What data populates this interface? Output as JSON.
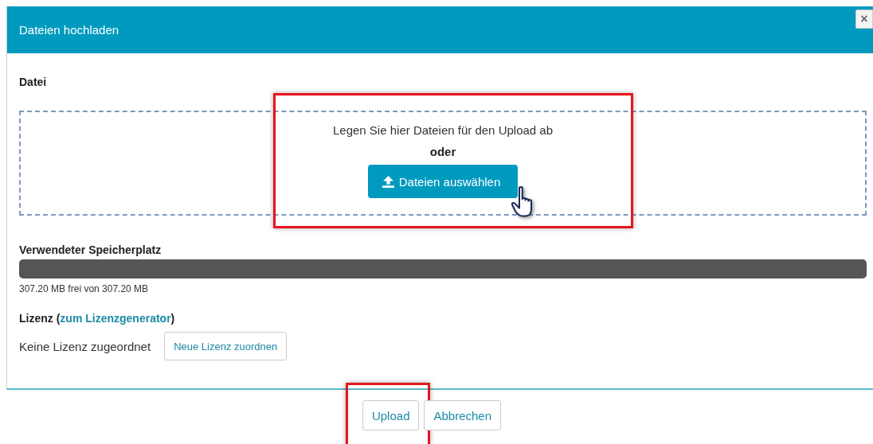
{
  "dialog": {
    "title": "Dateien hochladen",
    "close_label": "×"
  },
  "file_section": {
    "label": "Datei",
    "drop_hint": "Legen Sie hier Dateien für den Upload ab",
    "separator": "oder",
    "choose_button": "Dateien auswählen",
    "highlighted": true
  },
  "storage": {
    "label": "Verwendeter Speicherplatz",
    "level": 0,
    "reading": "307.20 MB frei von 307.20 MB"
  },
  "license": {
    "label": "Lizenz (",
    "link": "zum Lizenzgenerator",
    "label_end": ")",
    "status": "Keine Lizenz zugeordnet",
    "assign_button": "Neue Lizenz zuordnen"
  },
  "buttons": [
    {
      "label": "Upload",
      "highlighted": true
    },
    {
      "label": "Abbrechen",
      "highlighted": false
    }
  ]
}
